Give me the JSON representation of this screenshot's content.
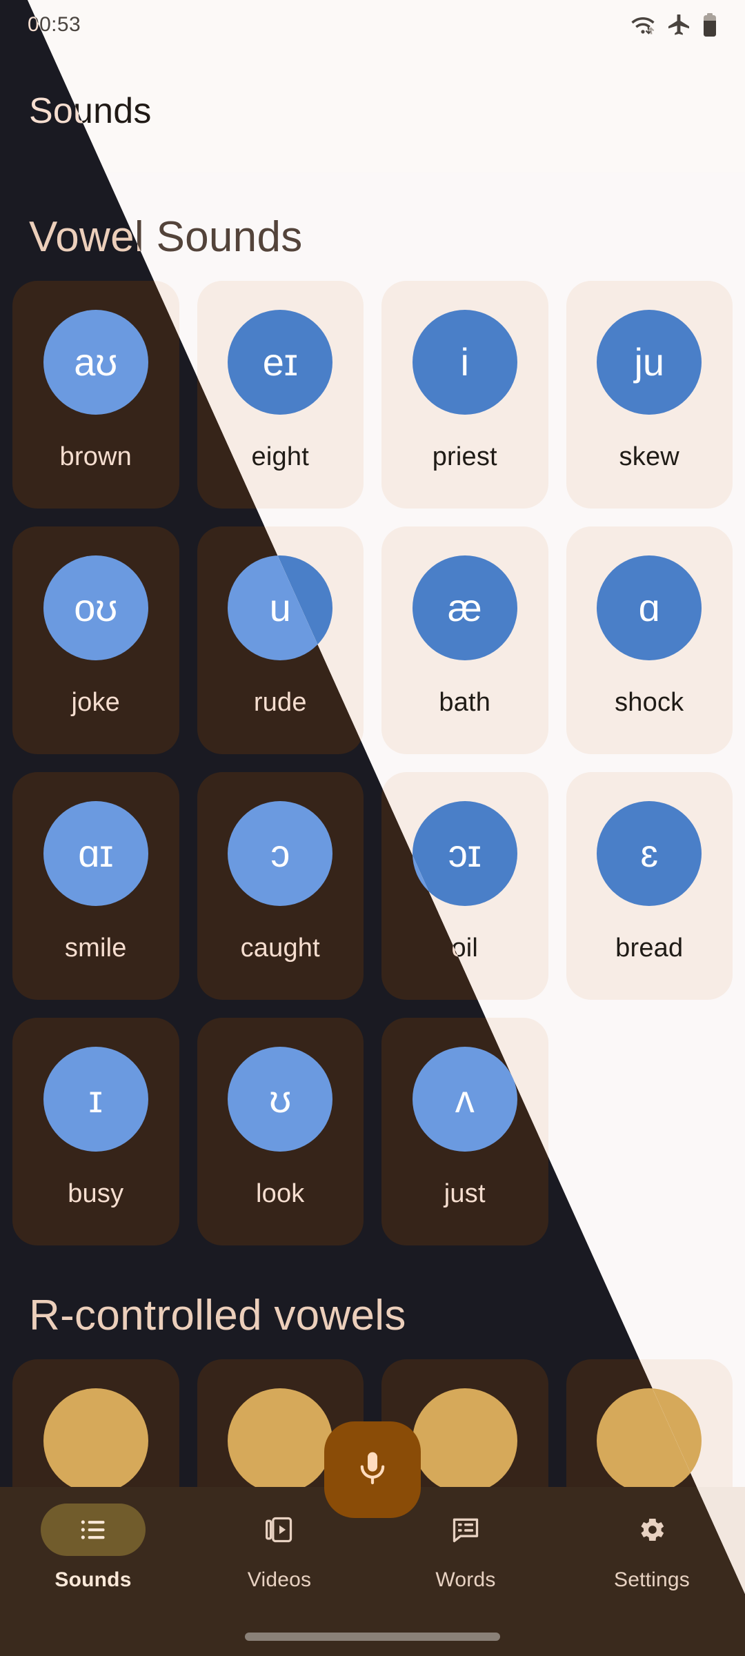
{
  "status_bar": {
    "time": "00:53",
    "icons": [
      "wifi-data-icon",
      "airplane-mode-icon",
      "battery-icon"
    ]
  },
  "app_bar": {
    "title": "Sounds"
  },
  "sections": [
    {
      "title": "Vowel Sounds",
      "cards": [
        {
          "ipa": "aʊ",
          "word": "brown"
        },
        {
          "ipa": "eɪ",
          "word": "eight"
        },
        {
          "ipa": "i",
          "word": "priest"
        },
        {
          "ipa": "ju",
          "word": "skew"
        },
        {
          "ipa": "oʊ",
          "word": "joke"
        },
        {
          "ipa": "u",
          "word": "rude"
        },
        {
          "ipa": "æ",
          "word": "bath"
        },
        {
          "ipa": "ɑ",
          "word": "shock"
        },
        {
          "ipa": "ɑɪ",
          "word": "smile"
        },
        {
          "ipa": "ɔ",
          "word": "caught"
        },
        {
          "ipa": "ɔɪ",
          "word": "oil"
        },
        {
          "ipa": "ɛ",
          "word": "bread"
        },
        {
          "ipa": "ɪ",
          "word": "busy"
        },
        {
          "ipa": "ʊ",
          "word": "look"
        },
        {
          "ipa": "ʌ",
          "word": "just"
        },
        {
          "ipa": "",
          "word": ""
        }
      ]
    },
    {
      "title": "R-controlled vowels",
      "cards": [
        {
          "ipa": "",
          "word": ""
        },
        {
          "ipa": "",
          "word": ""
        },
        {
          "ipa": "",
          "word": ""
        },
        {
          "ipa": "",
          "word": ""
        }
      ]
    }
  ],
  "fab": {
    "icon": "microphone-icon"
  },
  "bottom_nav": {
    "items": [
      {
        "label": "Sounds",
        "icon": "list-icon",
        "active": true
      },
      {
        "label": "Videos",
        "icon": "video-icon",
        "active": false
      },
      {
        "label": "Words",
        "icon": "chat-list-icon",
        "active": false
      },
      {
        "label": "Settings",
        "icon": "gear-icon",
        "active": false
      }
    ]
  },
  "colors": {
    "dark_background": "#1a1a22",
    "dark_surface": "#362419",
    "light_background": "#fbf8f8",
    "light_surface": "#f7ece5",
    "ipa_circle_blue": "#4a7fc8",
    "fab_brown": "#8a4c07",
    "active_pill": "#715c2c",
    "heading_tan": "#eccfbb"
  }
}
